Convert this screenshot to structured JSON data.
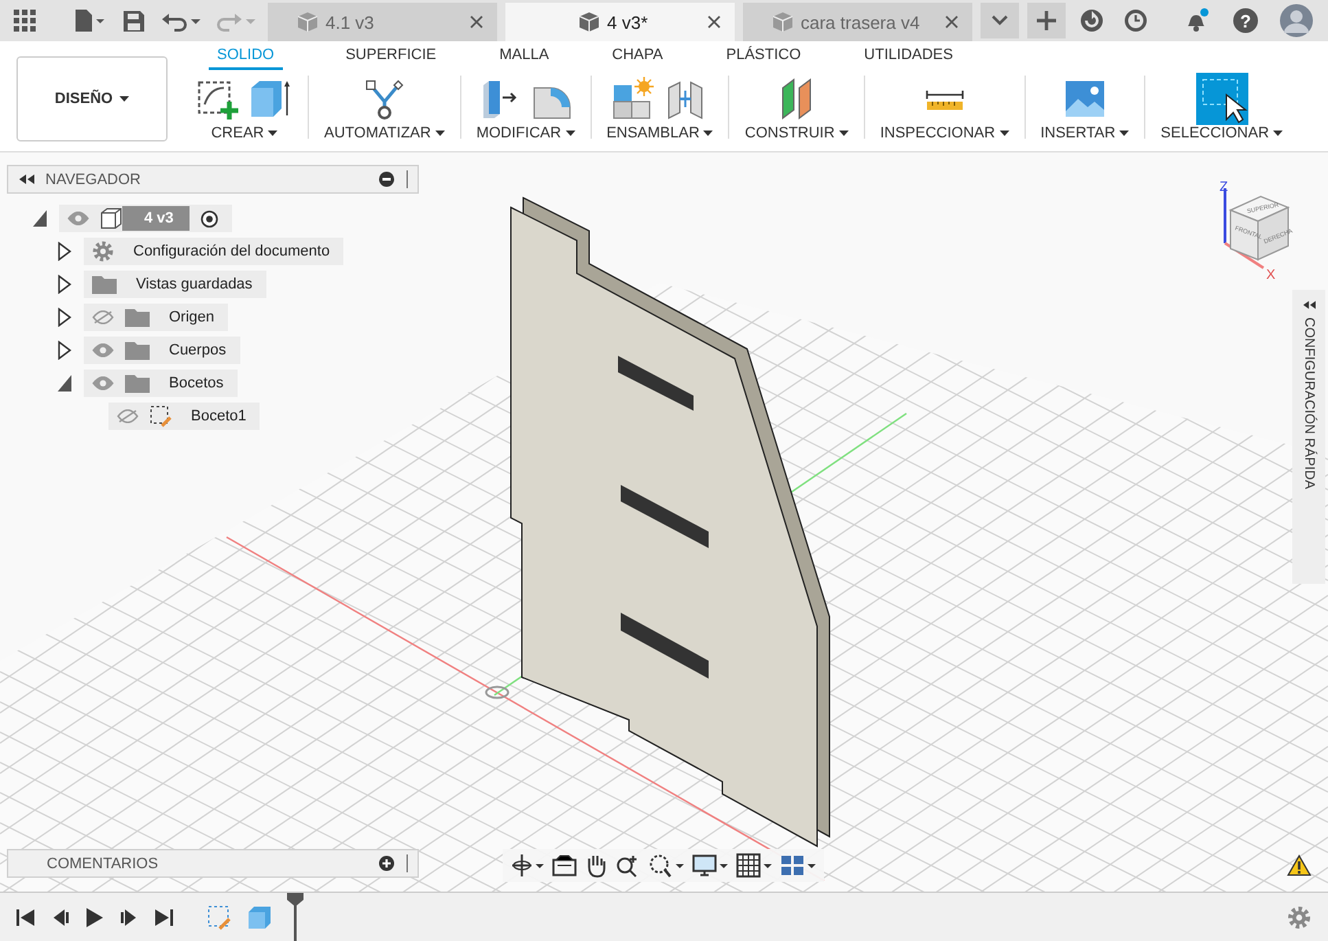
{
  "top_bar": {
    "tabs": [
      {
        "label": "4.1 v3",
        "selected": false
      },
      {
        "label": "4 v3*",
        "selected": true
      },
      {
        "label": "cara trasera v4",
        "selected": false
      }
    ],
    "help": "?"
  },
  "toolbar": {
    "workspace": "DISEÑO",
    "tabs": [
      {
        "label": "SOLIDO",
        "selected": true
      },
      {
        "label": "SUPERFICIE",
        "selected": false
      },
      {
        "label": "MALLA",
        "selected": false
      },
      {
        "label": "CHAPA",
        "selected": false
      },
      {
        "label": "PLÁSTICO",
        "selected": false
      },
      {
        "label": "UTILIDADES",
        "selected": false
      }
    ],
    "groups": [
      {
        "label": "CREAR"
      },
      {
        "label": "AUTOMATIZAR"
      },
      {
        "label": "MODIFICAR"
      },
      {
        "label": "ENSAMBLAR"
      },
      {
        "label": "CONSTRUIR"
      },
      {
        "label": "INSPECCIONAR"
      },
      {
        "label": "INSERTAR"
      },
      {
        "label": "SELECCIONAR"
      }
    ]
  },
  "navigator": {
    "title": "NAVEGADOR",
    "tree": [
      {
        "label": "4 v3",
        "kind": "component",
        "visible": true,
        "expanded": true,
        "children": [
          {
            "label": "Configuración del documento",
            "kind": "settings",
            "expanded": false
          },
          {
            "label": "Vistas guardadas",
            "kind": "folder",
            "expanded": false
          },
          {
            "label": "Origen",
            "kind": "folder",
            "visible": false,
            "expanded": false
          },
          {
            "label": "Cuerpos",
            "kind": "folder",
            "visible": true,
            "expanded": false
          },
          {
            "label": "Bocetos",
            "kind": "folder",
            "visible": true,
            "expanded": true,
            "children": [
              {
                "label": "Boceto1",
                "kind": "sketch",
                "visible": false
              }
            ]
          }
        ]
      }
    ]
  },
  "view_cube": {
    "faces": [
      "SUPERIOR",
      "FRONTAL",
      "DERECHA"
    ],
    "axes": [
      "Z",
      "X"
    ]
  },
  "quick_settings": {
    "label": "CONFIGURACIÓN RÁPIDA"
  },
  "comments": {
    "title": "COMENTARIOS"
  }
}
